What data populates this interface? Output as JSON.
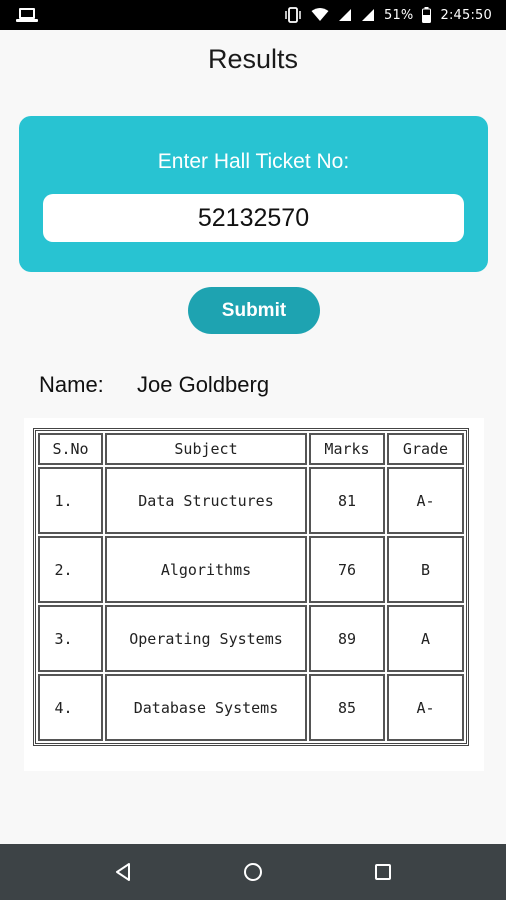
{
  "status_bar": {
    "battery_percent": "51%",
    "time": "2:45:50"
  },
  "header": {
    "title": "Results"
  },
  "ticket_form": {
    "label": "Enter Hall Ticket No:",
    "ticket_value": "52132570",
    "submit_label": "Submit",
    "card_color": "#28c3d2",
    "button_color": "#1ea3b1"
  },
  "student": {
    "name_label": "Name:",
    "name_value": "Joe Goldberg"
  },
  "results_table": {
    "headers": [
      "S.No",
      "Subject",
      "Marks",
      "Grade"
    ],
    "rows": [
      {
        "sno": "1.",
        "subject": "Data Structures",
        "marks": "81",
        "grade": "A-"
      },
      {
        "sno": "2.",
        "subject": "Algorithms",
        "marks": "76",
        "grade": "B"
      },
      {
        "sno": "3.",
        "subject": "Operating Systems",
        "marks": "89",
        "grade": "A"
      },
      {
        "sno": "4.",
        "subject": "Database Systems",
        "marks": "85",
        "grade": "A-"
      }
    ]
  },
  "nav_bar": {
    "icons": [
      "back-icon",
      "home-icon",
      "recents-icon"
    ]
  }
}
